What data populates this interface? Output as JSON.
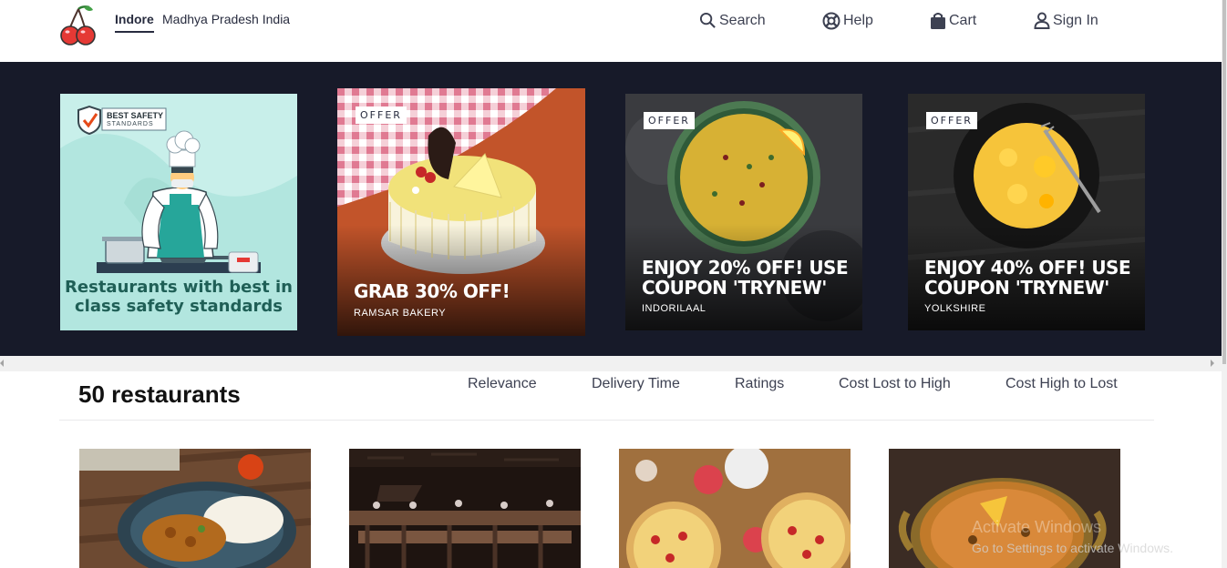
{
  "header": {
    "location_city": "Indore",
    "location_rest": "Madhya Pradesh India",
    "nav": {
      "search": "Search",
      "help": "Help",
      "cart": "Cart",
      "signin": "Sign In"
    }
  },
  "offers": [
    {
      "tag": "",
      "title_lines": [
        "Restaurants with best in",
        "class safety standards"
      ],
      "badge_line1": "BEST SAFETY",
      "badge_line2": "STANDARDS",
      "subtitle": ""
    },
    {
      "tag": "OFFER",
      "title": "GRAB 30% OFF!",
      "subtitle": "RAMSAR BAKERY"
    },
    {
      "tag": "OFFER",
      "title_line1": "ENJOY 20% OFF! USE",
      "title_line2": "COUPON 'TRYNEW'",
      "subtitle": "INDORILAAL"
    },
    {
      "tag": "OFFER",
      "title_line1": "ENJOY 40% OFF! USE",
      "title_line2": "COUPON 'TRYNEW'",
      "subtitle": "YOLKSHIRE"
    }
  ],
  "restaurants": {
    "count_label": "50 restaurants",
    "sort_options": [
      "Relevance",
      "Delivery Time",
      "Ratings",
      "Cost Lost to High",
      "Cost High to Lost"
    ]
  },
  "watermark": {
    "line1": "Activate Windows",
    "line2": "Go to Settings to activate Windows."
  },
  "colors": {
    "carousel_bg": "#171a29",
    "logo_red": "#e53935",
    "text_dark": "#282c3f"
  }
}
